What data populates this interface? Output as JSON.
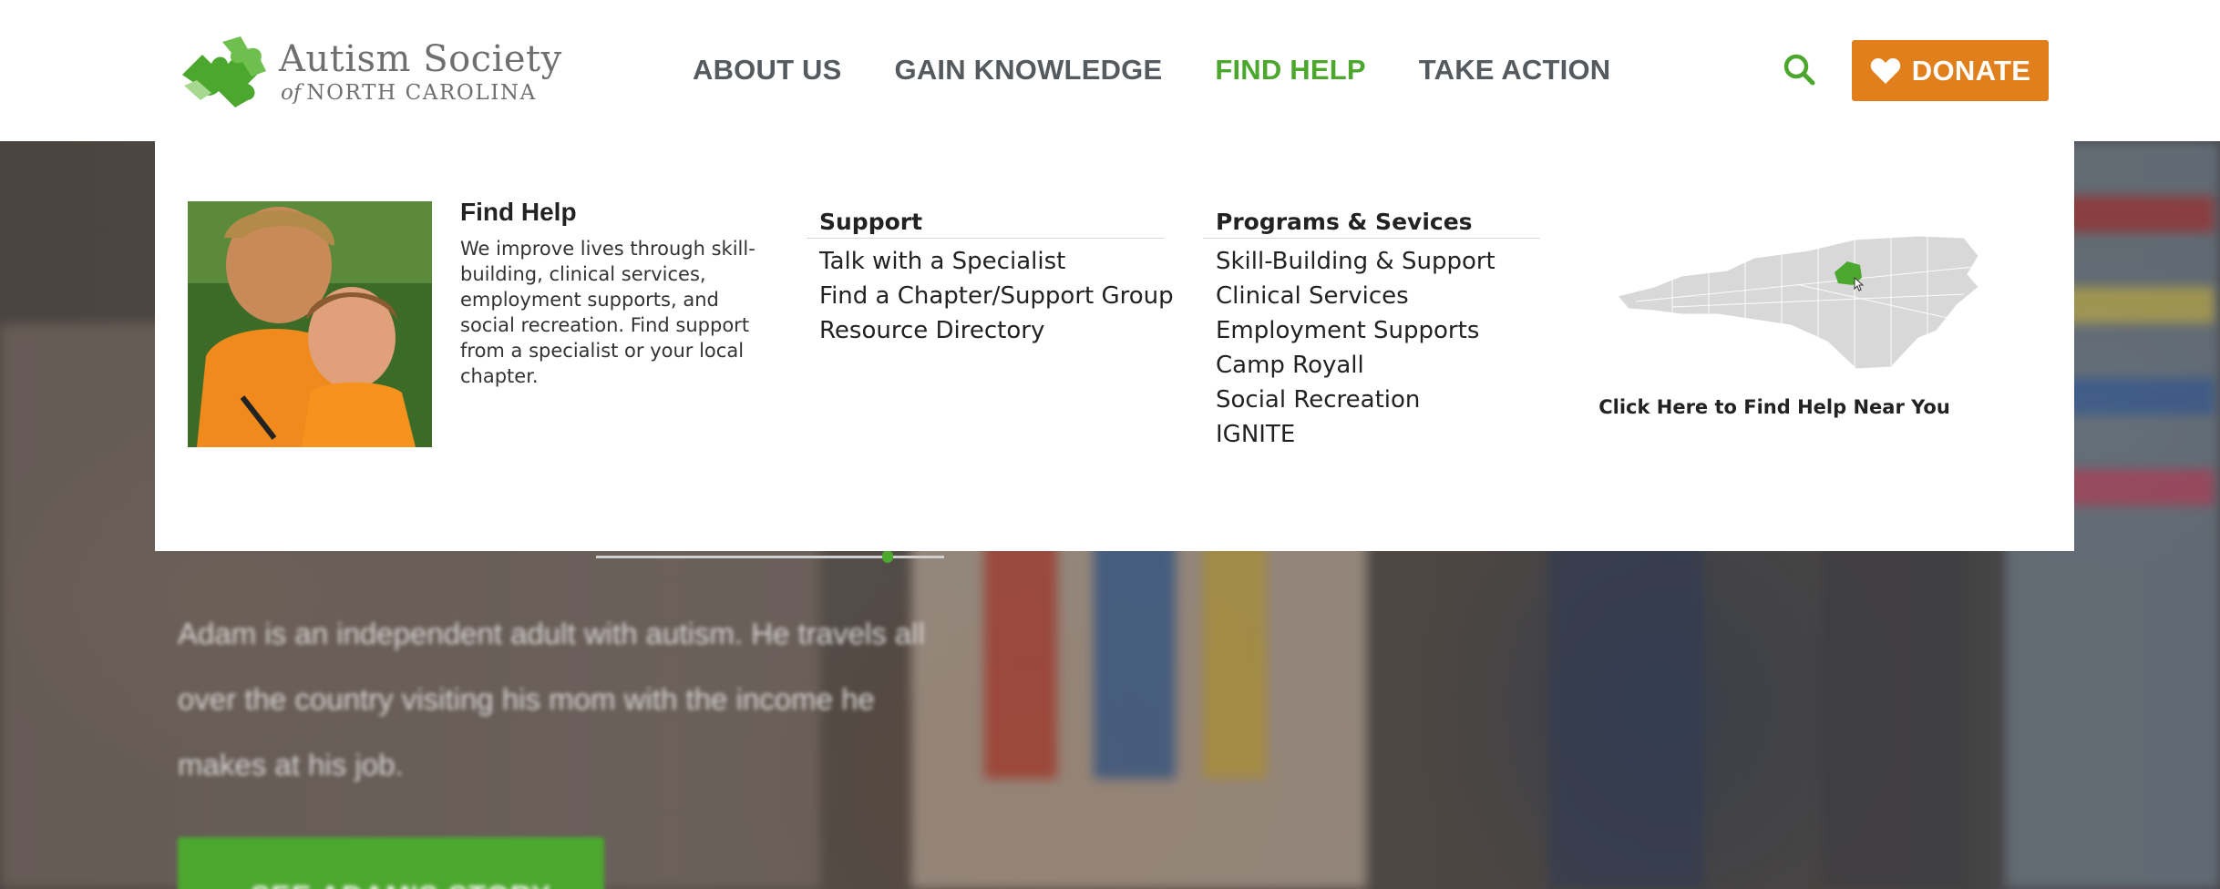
{
  "header": {
    "logo": {
      "line1": "Autism Society",
      "line2_of": "of",
      "line2_rest": "NORTH CAROLINA"
    },
    "nav": [
      {
        "label": "ABOUT US",
        "active": false
      },
      {
        "label": "GAIN KNOWLEDGE",
        "active": false
      },
      {
        "label": "FIND HELP",
        "active": true
      },
      {
        "label": "TAKE ACTION",
        "active": false
      }
    ],
    "search_icon": "search-icon",
    "donate": {
      "label": "DONATE",
      "icon": "heart-icon",
      "color": "#e07f1c"
    }
  },
  "mega_menu": {
    "title": "Find Help",
    "description": "We improve lives through skill-building, clinical services, employment supports, and social recreation. Find support from a specialist or your local chapter.",
    "support": {
      "heading": "Support",
      "items": [
        "Talk with a Specialist",
        "Find a Chapter/Support Group",
        "Resource Directory"
      ]
    },
    "programs": {
      "heading": "Programs & Sevices",
      "items": [
        "Skill-Building & Support",
        "Clinical Services",
        "Employment Supports",
        "Camp Royall",
        "Social Recreation",
        "IGNITE"
      ]
    },
    "map_caption": "Click Here to Find Help Near You"
  },
  "hero": {
    "story_text": "Adam is an independent adult with autism.  He travels all over the country visiting his mom with the income he makes at his job.",
    "cta_label": "SEE ADAM'S STORY"
  },
  "colors": {
    "brand_green": "#4ca72f",
    "donate_orange": "#e07f1c",
    "nav_gray": "#555a5f"
  }
}
